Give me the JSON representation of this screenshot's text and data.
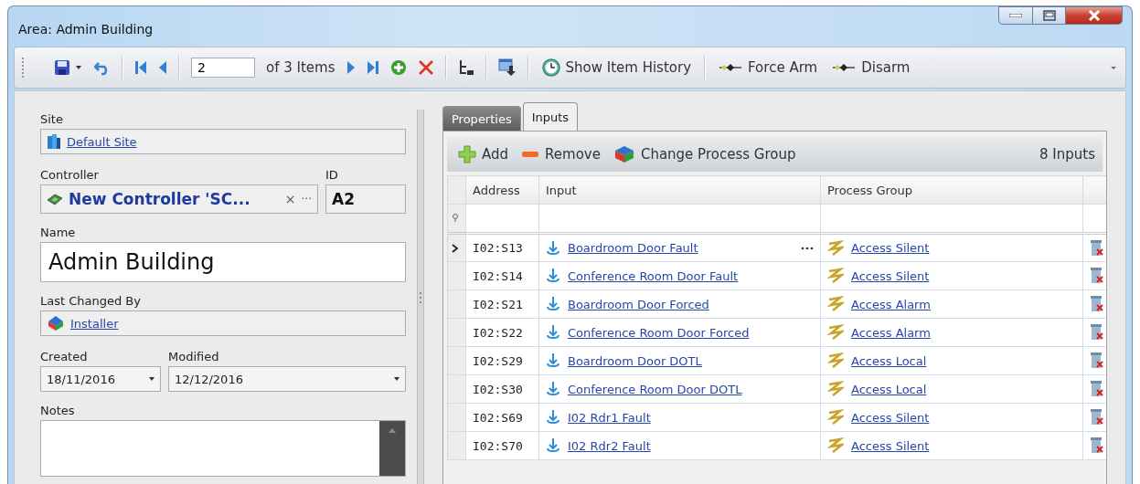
{
  "window": {
    "title": "Area: Admin Building"
  },
  "toolbar": {
    "record": "2",
    "record_count": "of 3 Items",
    "history": "Show Item History",
    "force_arm": "Force Arm",
    "disarm": "Disarm"
  },
  "form": {
    "site_label": "Site",
    "site": "Default Site",
    "controller_label": "Controller",
    "controller": "New Controller 'SC...",
    "clear": "×",
    "more": "···",
    "id_label": "ID",
    "id": "A2",
    "name_label": "Name",
    "name": "Admin Building",
    "changed_label": "Last Changed By",
    "changed_by": "Installer",
    "created_label": "Created",
    "created": "18/11/2016",
    "modified_label": "Modified",
    "modified": "12/12/2016",
    "notes_label": "Notes"
  },
  "tabs": [
    {
      "label": "Properties",
      "selected": false
    },
    {
      "label": "Inputs",
      "selected": true
    }
  ],
  "inputs_toolbar": {
    "add": "Add",
    "remove": "Remove",
    "change_group": "Change Process Group",
    "count": "8 Inputs"
  },
  "table": {
    "columns": [
      "Address",
      "Input",
      "Process Group"
    ],
    "rows": [
      {
        "address": "I02:S13",
        "input": "Boardroom Door Fault",
        "group": "Access Silent",
        "current": true
      },
      {
        "address": "I02:S14",
        "input": "Conference Room Door Fault",
        "group": "Access Silent",
        "current": false
      },
      {
        "address": "I02:S21",
        "input": "Boardroom Door Forced",
        "group": "Access Alarm",
        "current": false
      },
      {
        "address": "I02:S22",
        "input": "Conference Room Door Forced",
        "group": "Access Alarm",
        "current": false
      },
      {
        "address": "I02:S29",
        "input": "Boardroom Door DOTL",
        "group": "Access Local",
        "current": false
      },
      {
        "address": "I02:S30",
        "input": "Conference Room Door DOTL",
        "group": "Access Local",
        "current": false
      },
      {
        "address": "I02:S69",
        "input": "I02 Rdr1 Fault",
        "group": "Access Silent",
        "current": false
      },
      {
        "address": "I02:S70",
        "input": "I02 Rdr2 Fault",
        "group": "Access Silent",
        "current": false
      }
    ]
  }
}
